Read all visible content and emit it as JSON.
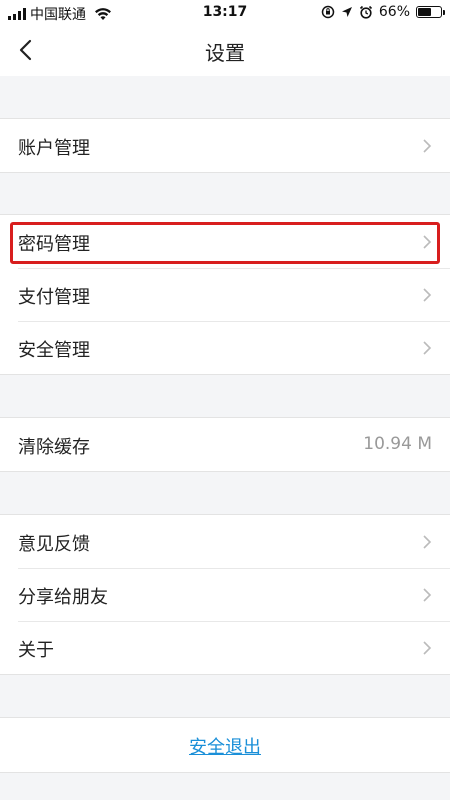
{
  "status_bar": {
    "carrier": "中国联通",
    "time": "13:17",
    "battery_text": "66%",
    "battery_level": 0.66
  },
  "header": {
    "back_icon": "chevron-left-icon",
    "title": "设置"
  },
  "groups": [
    {
      "items": [
        {
          "label": "账户管理"
        }
      ]
    },
    {
      "items": [
        {
          "label": "密码管理"
        },
        {
          "label": "支付管理"
        },
        {
          "label": "安全管理"
        }
      ]
    },
    {
      "items": [
        {
          "label": "清除缓存",
          "value": "10.94 M"
        }
      ]
    },
    {
      "items": [
        {
          "label": "意见反馈"
        },
        {
          "label": "分享给朋友"
        },
        {
          "label": "关于"
        }
      ]
    }
  ],
  "logout_label": "安全退出",
  "colors": {
    "highlight": "#d81e1e",
    "link": "#1a8fd8",
    "background": "#f4f5f7"
  }
}
